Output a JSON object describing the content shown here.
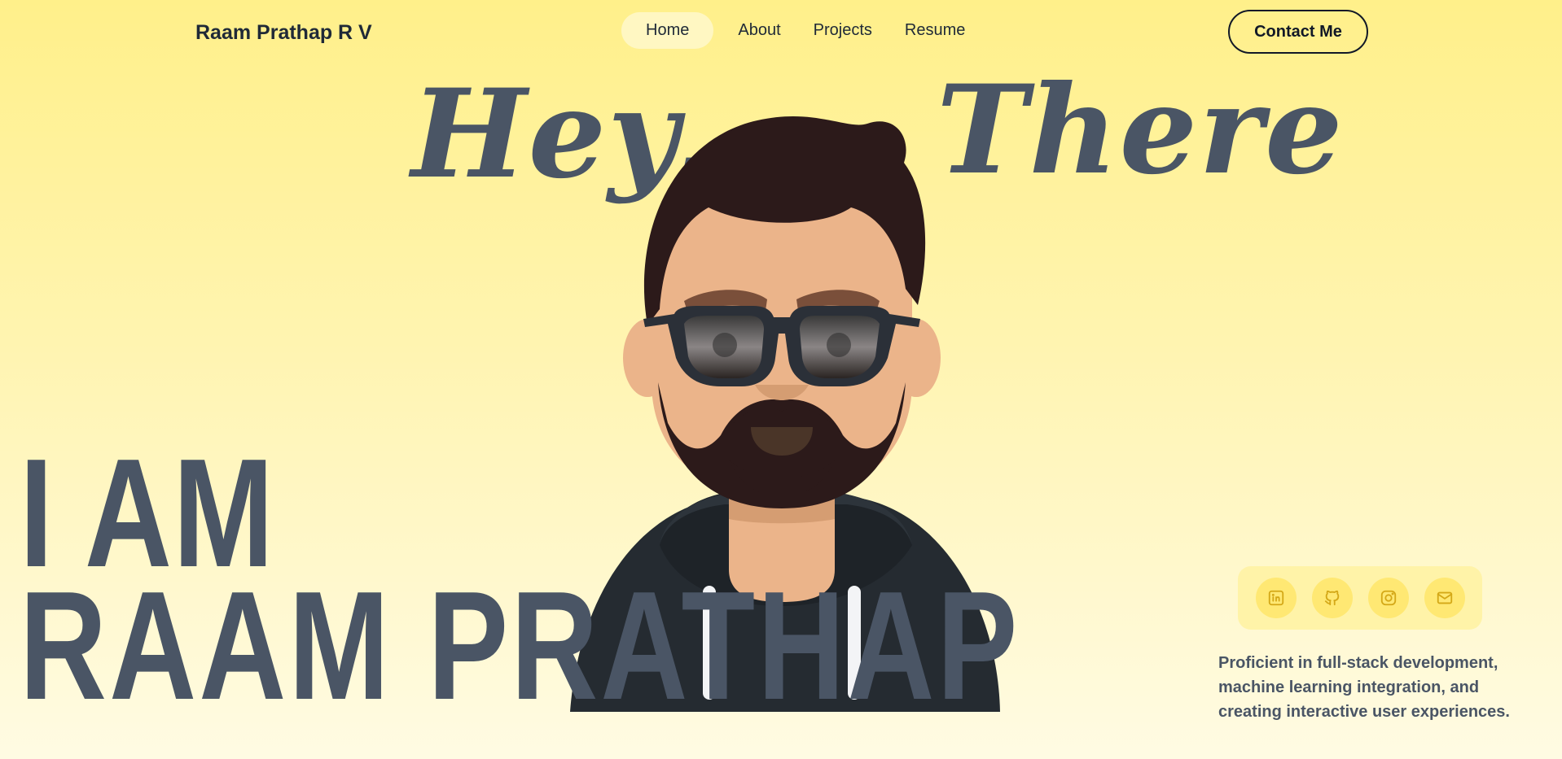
{
  "nav": {
    "brand": "Raam Prathap R V",
    "links": [
      {
        "label": "Home",
        "active": true
      },
      {
        "label": "About",
        "active": false
      },
      {
        "label": "Projects",
        "active": false
      },
      {
        "label": "Resume",
        "active": false
      }
    ],
    "contact_label": "Contact Me"
  },
  "hero": {
    "greeting_word1": "Hey,",
    "greeting_word2": "There",
    "intro_line1": "I AM",
    "intro_line2": "RAAM PRATHAP"
  },
  "social": {
    "icons": [
      "linkedin-icon",
      "github-icon",
      "instagram-icon",
      "mail-icon"
    ]
  },
  "tagline": "Proficient in full-stack development, machine learning integration, and creating interactive user experiences.",
  "colors": {
    "heading": "#4a5565",
    "accent_yellow": "#ffe873",
    "icon_color": "#d4a817"
  }
}
